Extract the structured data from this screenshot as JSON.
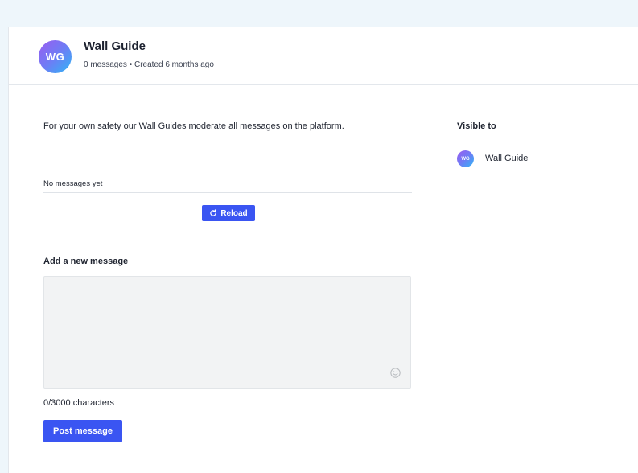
{
  "header": {
    "avatar_initials": "WG",
    "title": "Wall Guide",
    "subtitle": "0 messages • Created 6 months ago"
  },
  "main": {
    "notice": "For your own safety our Wall Guides moderate all messages on the platform.",
    "no_messages": "No messages yet",
    "reload_label": "Reload",
    "reload_icon": "reload-icon",
    "add_message_label": "Add a new message",
    "message_value": "",
    "emoji_icon": "emoji-icon",
    "char_count": "0/3000 characters",
    "post_label": "Post message"
  },
  "sidebar": {
    "visible_to_label": "Visible to",
    "members": [
      {
        "initials": "WG",
        "name": "Wall Guide"
      }
    ]
  },
  "colors": {
    "accent": "#3a55f2",
    "background": "#eef6fb"
  }
}
